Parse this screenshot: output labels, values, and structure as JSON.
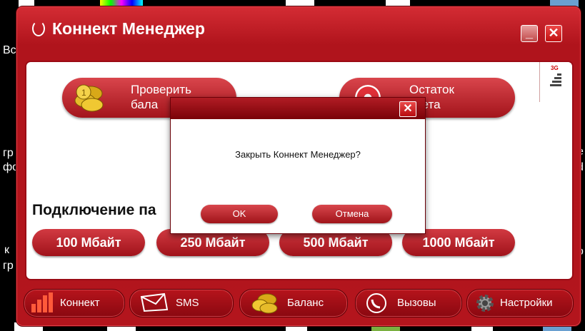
{
  "window": {
    "title": "Коннект Менеджер",
    "minimize_glyph": "_",
    "close_glyph": "✕"
  },
  "actions": {
    "check_balance": "Проверить баланс",
    "check_balance_line1": "Проверить",
    "check_balance_line2": "бала",
    "remaining_package_line1": "Остаток",
    "remaining_package_line2": "кета",
    "network_badge": "3G"
  },
  "packages": {
    "title": "Подключение па",
    "items": [
      "100 Мбайт",
      "250 Мбайт",
      "500 Мбайт",
      "1000 Мбайт"
    ]
  },
  "bottom_nav": {
    "items": [
      {
        "label": "Коннект",
        "icon": "signal-bars-icon"
      },
      {
        "label": "SMS",
        "icon": "envelope-icon"
      },
      {
        "label": "Баланс",
        "icon": "coins-icon"
      },
      {
        "label": "Вызовы",
        "icon": "phone-icon"
      },
      {
        "label": "Настройки",
        "icon": "gear-icon"
      }
    ]
  },
  "dialog": {
    "message": "Закрыть Коннект Менеджер?",
    "ok_label": "OK",
    "cancel_label": "Отмена",
    "close_glyph": "✕"
  },
  "desktop": {
    "left_fragments": [
      "Вс",
      "гр",
      "фо",
      "к",
      "гр"
    ],
    "right_fragments": [
      "е",
      "d",
      "о"
    ]
  },
  "colors": {
    "brand_red": "#b3151d",
    "accent_light": "#d9454c"
  }
}
